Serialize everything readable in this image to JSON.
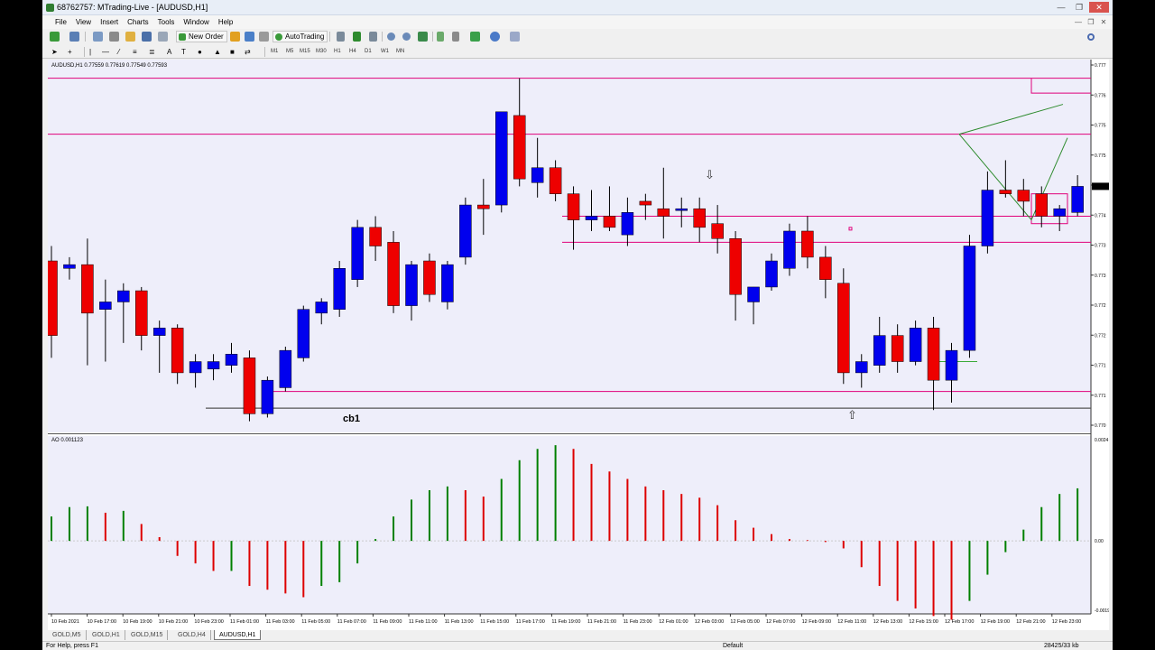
{
  "window": {
    "title": "68762757: MTrading-Live - [AUDUSD,H1]",
    "controls": [
      "—",
      "❐",
      "✕"
    ]
  },
  "menu": [
    "File",
    "View",
    "Insert",
    "Charts",
    "Tools",
    "Window",
    "Help"
  ],
  "toolbar": {
    "new_order": "New Order",
    "auto_trading": "AutoTrading",
    "timeframes": [
      "M1",
      "M5",
      "M15",
      "M30",
      "H1",
      "H4",
      "D1",
      "W1",
      "MN"
    ]
  },
  "chart": {
    "info": "AUDUSD,H1  0.77559 0.77619 0.77549 0.77593",
    "indicator_label": "AO 0.001123",
    "text_label": "cb1",
    "price_ticks": [
      "0.777",
      "0.776",
      "0.775",
      "0.775",
      "0.774",
      "0.774",
      "0.773",
      "0.773",
      "0.772",
      "0.772",
      "0.771",
      "0.771",
      "0.770"
    ],
    "indicator_ticks": [
      "0.0024",
      "0.00",
      "-0.0019"
    ],
    "time_ticks": [
      "10 Feb 2021",
      "10 Feb 17:00",
      "10 Feb 19:00",
      "10 Feb 21:00",
      "10 Feb 23:00",
      "11 Feb 01:00",
      "11 Feb 03:00",
      "11 Feb 05:00",
      "11 Feb 07:00",
      "11 Feb 09:00",
      "11 Feb 11:00",
      "11 Feb 13:00",
      "11 Feb 15:00",
      "11 Feb 17:00",
      "11 Feb 19:00",
      "11 Feb 21:00",
      "11 Feb 23:00",
      "12 Feb 01:00",
      "12 Feb 03:00",
      "12 Feb 05:00",
      "12 Feb 07:00",
      "12 Feb 09:00",
      "12 Feb 11:00",
      "12 Feb 13:00",
      "12 Feb 15:00",
      "12 Feb 17:00",
      "12 Feb 19:00",
      "12 Feb 21:00",
      "12 Feb 23:00"
    ],
    "colors": {
      "background": "#eeeefa",
      "bull": "#0000ee",
      "bear": "#ee0000",
      "level": "#e0007a",
      "ao_up": "#008000",
      "ao_down": "#dd0000",
      "trend": "#2e8b2e"
    },
    "candles": [
      [
        0.7748,
        0.7752,
        0.7722,
        0.7728
      ],
      [
        0.7746,
        0.7749,
        0.7743,
        0.7747
      ],
      [
        0.7747,
        0.7754,
        0.772,
        0.7734
      ],
      [
        0.7735,
        0.7743,
        0.7721,
        0.7737
      ],
      [
        0.7737,
        0.7742,
        0.7726,
        0.774
      ],
      [
        0.774,
        0.7741,
        0.7724,
        0.7728
      ],
      [
        0.7728,
        0.7732,
        0.7718,
        0.773
      ],
      [
        0.773,
        0.7731,
        0.7715,
        0.7718
      ],
      [
        0.7718,
        0.7723,
        0.7714,
        0.7721
      ],
      [
        0.7719,
        0.7723,
        0.7716,
        0.7721
      ],
      [
        0.772,
        0.7726,
        0.7718,
        0.7723
      ],
      [
        0.7722,
        0.7724,
        0.7705,
        0.7707
      ],
      [
        0.7707,
        0.7717,
        0.7706,
        0.7716
      ],
      [
        0.7714,
        0.7725,
        0.7713,
        0.7724
      ],
      [
        0.7722,
        0.7736,
        0.7721,
        0.7735
      ],
      [
        0.7734,
        0.7738,
        0.7731,
        0.7737
      ],
      [
        0.7735,
        0.7748,
        0.7733,
        0.7746
      ],
      [
        0.7743,
        0.7759,
        0.7741,
        0.7757
      ],
      [
        0.7757,
        0.776,
        0.7748,
        0.7752
      ],
      [
        0.7753,
        0.7756,
        0.7734,
        0.7736
      ],
      [
        0.7736,
        0.7748,
        0.7732,
        0.7747
      ],
      [
        0.7748,
        0.775,
        0.7737,
        0.7739
      ],
      [
        0.7737,
        0.7748,
        0.7735,
        0.7747
      ],
      [
        0.7749,
        0.7765,
        0.7747,
        0.7763
      ],
      [
        0.7763,
        0.777,
        0.7755,
        0.7762
      ],
      [
        0.7763,
        0.7772,
        0.7761,
        0.7788
      ],
      [
        0.7787,
        0.7797,
        0.7768,
        0.777
      ],
      [
        0.7769,
        0.7781,
        0.7765,
        0.7773
      ],
      [
        0.7773,
        0.7775,
        0.7764,
        0.7766
      ],
      [
        0.7766,
        0.7768,
        0.7751,
        0.7759
      ],
      [
        0.7759,
        0.7767,
        0.7756,
        0.776
      ],
      [
        0.776,
        0.7768,
        0.7756,
        0.7757
      ],
      [
        0.7755,
        0.7765,
        0.7752,
        0.7761
      ],
      [
        0.7764,
        0.7766,
        0.7759,
        0.7763
      ],
      [
        0.7762,
        0.7773,
        0.7754,
        0.776
      ],
      [
        0.7762,
        0.7765,
        0.7757,
        0.7762
      ],
      [
        0.7762,
        0.7765,
        0.7753,
        0.7757
      ],
      [
        0.7758,
        0.7763,
        0.775,
        0.7754
      ],
      [
        0.7754,
        0.7756,
        0.7732,
        0.7739
      ],
      [
        0.7737,
        0.7741,
        0.7731,
        0.7741
      ],
      [
        0.7741,
        0.775,
        0.774,
        0.7748
      ],
      [
        0.7746,
        0.7758,
        0.7744,
        0.7756
      ],
      [
        0.7756,
        0.776,
        0.7746,
        0.7749
      ],
      [
        0.7749,
        0.7752,
        0.7738,
        0.7743
      ],
      [
        0.7742,
        0.7746,
        0.7715,
        0.7718
      ],
      [
        0.7718,
        0.7723,
        0.7714,
        0.7721
      ],
      [
        0.772,
        0.7733,
        0.7718,
        0.7728
      ],
      [
        0.7728,
        0.7731,
        0.7718,
        0.7721
      ],
      [
        0.7721,
        0.7732,
        0.772,
        0.773
      ],
      [
        0.773,
        0.7733,
        0.7708,
        0.7716
      ],
      [
        0.7716,
        0.7726,
        0.771,
        0.7724
      ],
      [
        0.7724,
        0.7755,
        0.7722,
        0.7752
      ],
      [
        0.7752,
        0.7772,
        0.775,
        0.7767
      ],
      [
        0.7767,
        0.7775,
        0.7765,
        0.7766
      ],
      [
        0.7767,
        0.777,
        0.776,
        0.7764
      ],
      [
        0.7766,
        0.7768,
        0.7757,
        0.776
      ],
      [
        0.776,
        0.7763,
        0.7756,
        0.7762
      ],
      [
        0.7761,
        0.7771,
        0.776,
        0.7768
      ]
    ],
    "ao": [
      0.00065,
      0.0009,
      0.00092,
      0.00075,
      0.0008,
      0.00045,
      0.0001,
      -0.0004,
      -0.0006,
      -0.0008,
      -0.0008,
      -0.0012,
      -0.0013,
      -0.0014,
      -0.0015,
      -0.0012,
      -0.0011,
      -0.0006,
      5e-05,
      0.00065,
      0.0011,
      0.00135,
      0.00145,
      0.00135,
      0.00118,
      0.00165,
      0.00215,
      0.00245,
      0.00255,
      0.00245,
      0.00205,
      0.00185,
      0.00165,
      0.00145,
      0.00135,
      0.00125,
      0.00115,
      0.00095,
      0.00055,
      0.00035,
      0.00018,
      5e-05,
      2e-05,
      -3e-05,
      -0.0002,
      -0.0007,
      -0.0012,
      -0.0016,
      -0.0018,
      -0.002,
      -0.0021,
      -0.0016,
      -0.0009,
      -0.0003,
      0.0003,
      0.0009,
      0.00125,
      0.0014
    ]
  },
  "tabs": [
    "GOLD,M5",
    "GOLD,H1",
    "GOLD,M15",
    "GOLD,H4",
    "AUDUSD,H1"
  ],
  "status": {
    "help": "For Help, press F1",
    "profile": "Default",
    "traffic": "28425/33 kb"
  }
}
